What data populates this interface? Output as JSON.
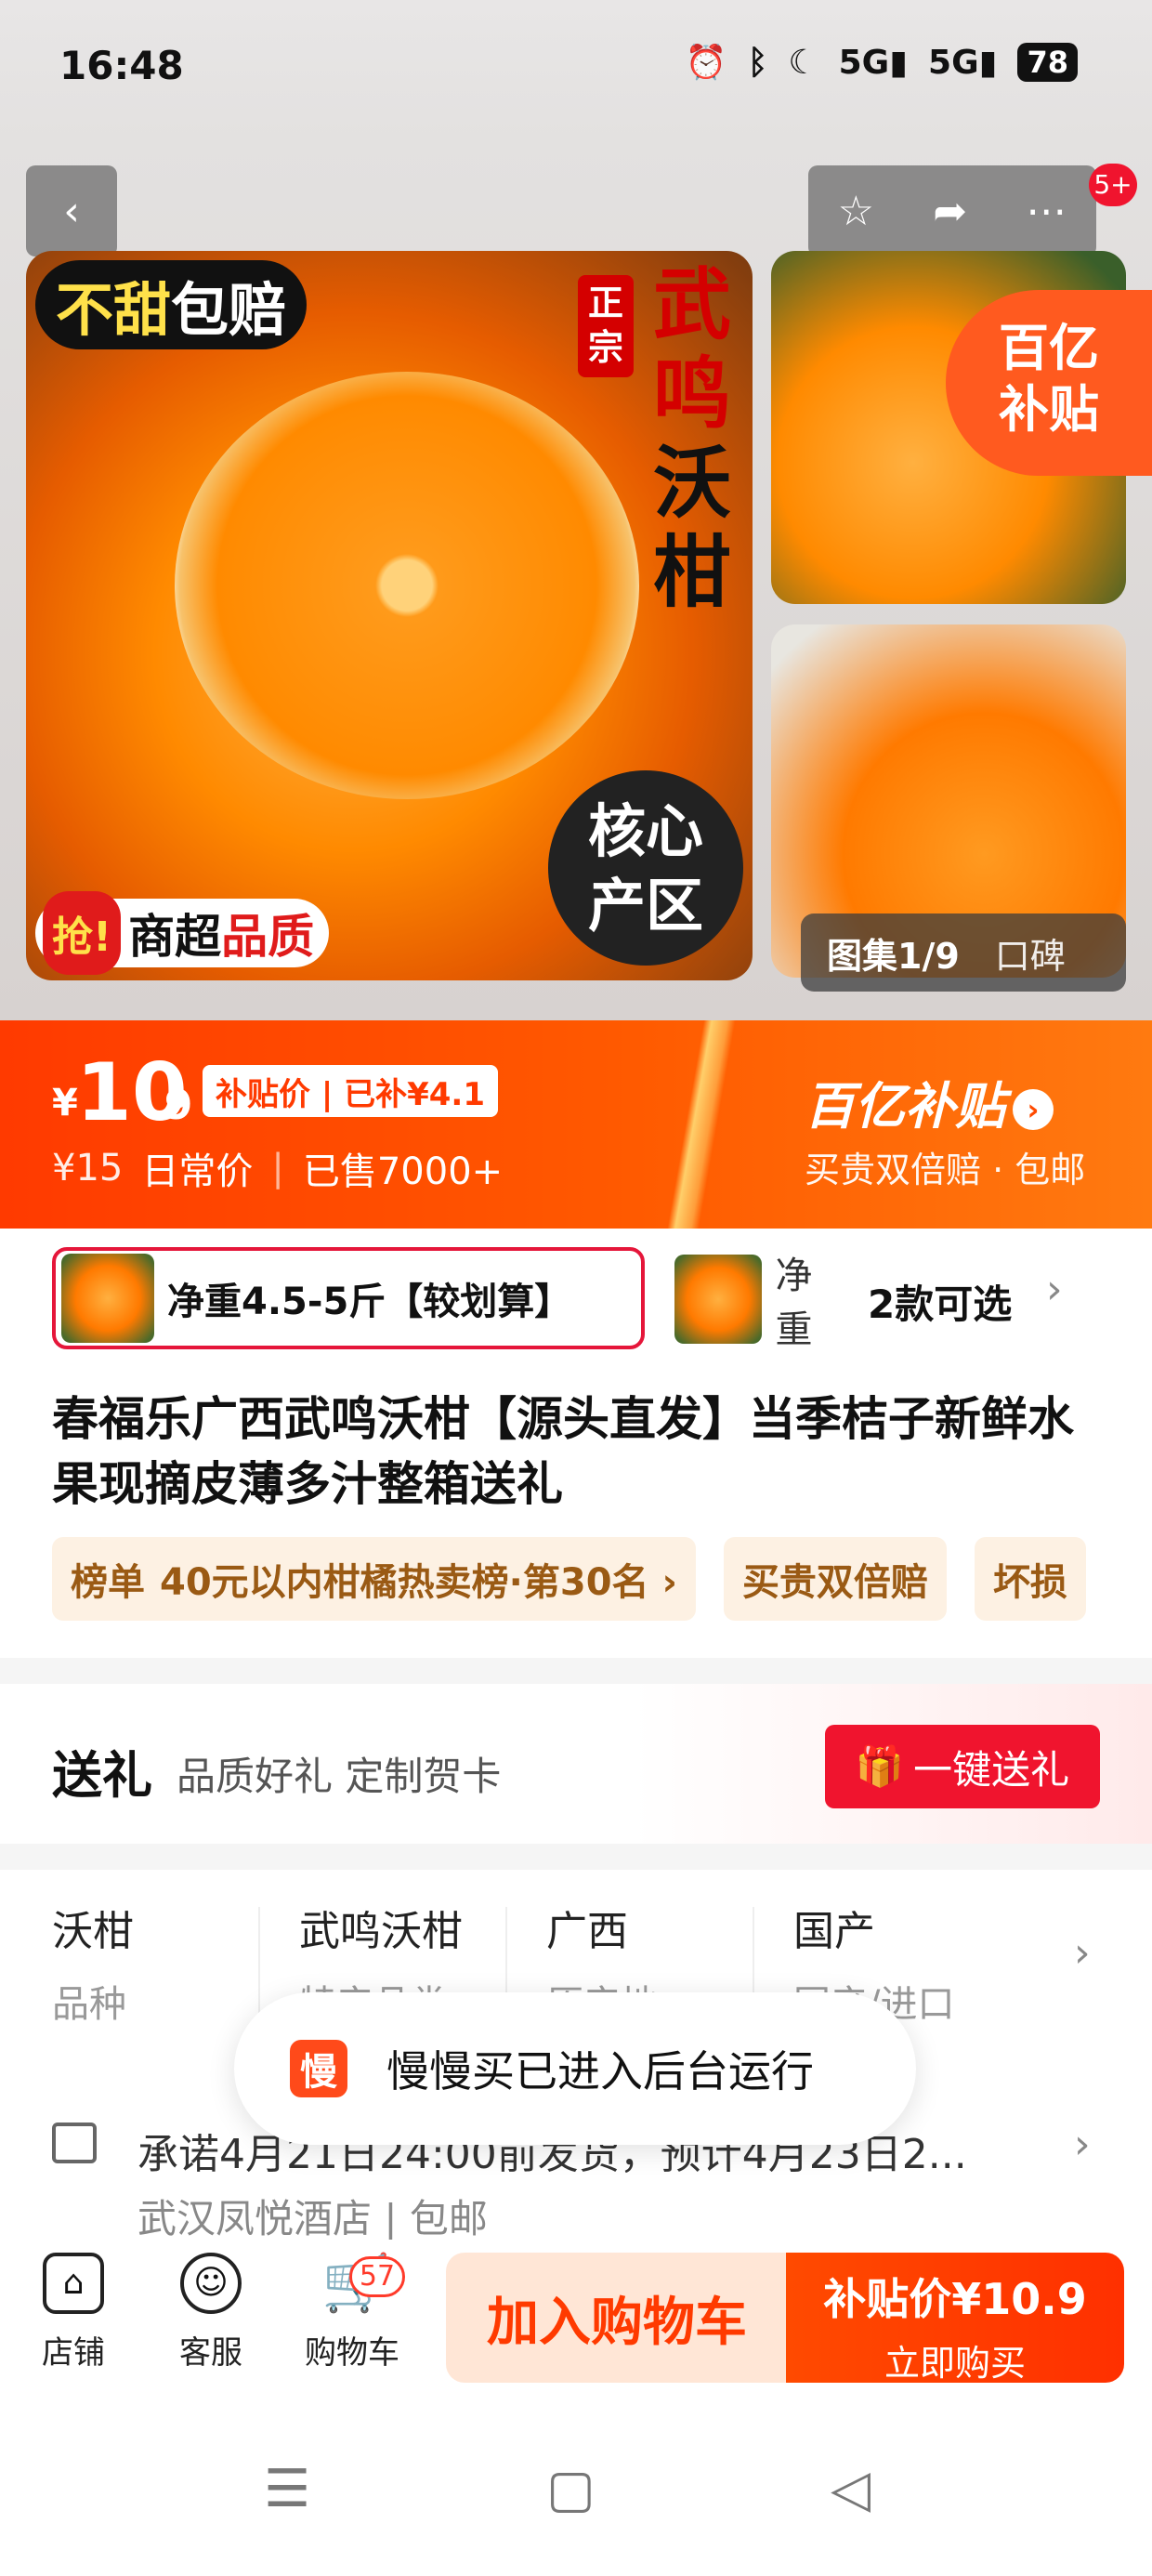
{
  "status_bar": {
    "time": "16:48",
    "battery": "78",
    "icons": [
      "alarm-icon",
      "bluetooth-icon",
      "moon-icon",
      "5g-signal-icon",
      "5g-signal-icon"
    ],
    "signal1": "5G",
    "signal2": "5G"
  },
  "top_nav": {
    "notification_badge": "5+"
  },
  "hero": {
    "badge_top_left_1": "不甜",
    "badge_top_left_2": "包赔",
    "zhengzong": "正宗",
    "vertical_title_1": "武鸣",
    "vertical_title_2": "沃柑",
    "core_area_1": "核心",
    "core_area_2": "产区",
    "qiang": "抢!",
    "quality_1": "商超",
    "quality_2": "品质",
    "subsidy_badge_1": "百亿",
    "subsidy_badge_2": "补贴",
    "gallery_label": "图集1/9",
    "reviews_label": "口碑"
  },
  "price": {
    "currency": "¥",
    "integer": "10",
    "decimal": ".9",
    "tag": "补贴价 | 已补¥4.1",
    "old_price": "¥15",
    "old_label": "日常价",
    "sold": "已售7000+",
    "program_title": "百亿补贴",
    "program_sub": "买贵双倍赔 · 包邮"
  },
  "variants": {
    "selected_label": "净重4.5-5斤【较划算】",
    "second_label": "净重",
    "more_label": "2款可选"
  },
  "product": {
    "title": "春福乐广西武鸣沃柑【源头直发】当季桔子新鲜水果现摘皮薄多汁整箱送礼"
  },
  "tags": [
    {
      "key": "榜单",
      "value": "40元以内柑橘热卖榜·第30名 ›"
    },
    {
      "key": "",
      "value": "买贵双倍赔"
    },
    {
      "key": "",
      "value": "坏损"
    }
  ],
  "gift": {
    "title": "送礼",
    "subtitle": "品质好礼 定制贺卡",
    "button": "一键送礼"
  },
  "attributes": [
    {
      "value": "沃柑",
      "key": "品种"
    },
    {
      "value": "武鸣沃柑",
      "key": "特产品类"
    },
    {
      "value": "广西",
      "key": "原产地"
    },
    {
      "value": "国产",
      "key": "国产/进口"
    }
  ],
  "toast": {
    "icon_text": "慢",
    "text": "慢慢买已进入后台运行"
  },
  "shipping": {
    "line1": "承诺4月21日24:00前发货，预计4月23日2...",
    "line2": "武汉凤悦酒店 | 包邮"
  },
  "bottom_bar": {
    "shop": "店铺",
    "service": "客服",
    "cart": "购物车",
    "cart_count": "57",
    "add_to_cart": "加入购物车",
    "buy_price": "补贴价¥10.9",
    "buy_now": "立即购买"
  },
  "colors": {
    "accent": "#ff4a00",
    "red": "#f0142e"
  }
}
